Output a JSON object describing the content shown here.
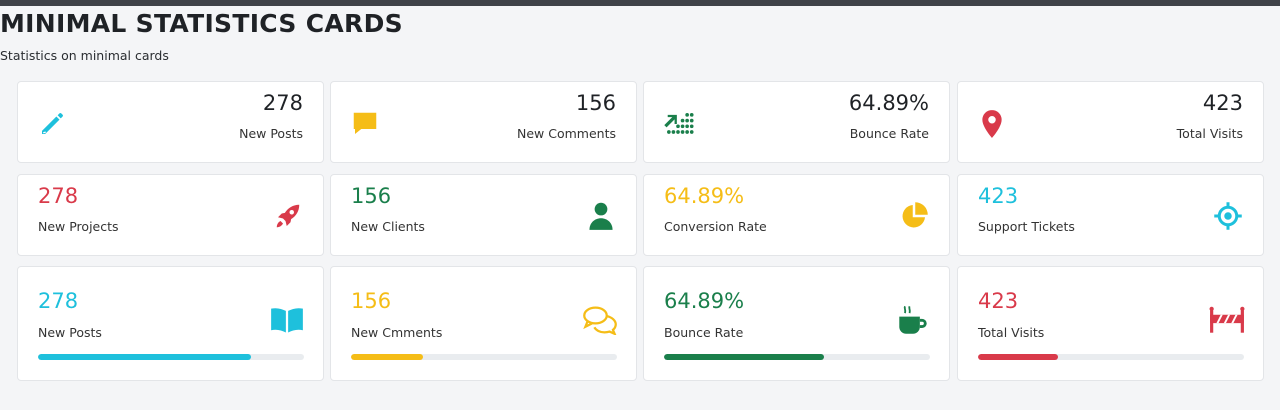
{
  "header": {
    "title": "MINIMAL STATISTICS CARDS",
    "subtitle": "Statistics on minimal cards"
  },
  "colors": {
    "cyan": "#1ec0dc",
    "yellow": "#f5bd17",
    "green": "#1a7f4b",
    "red": "#d93a4a"
  },
  "row1": [
    {
      "value": "278",
      "label": "New Posts",
      "icon": "pencil-icon"
    },
    {
      "value": "156",
      "label": "New Comments",
      "icon": "comment-icon"
    },
    {
      "value": "64.89%",
      "label": "Bounce Rate",
      "icon": "trend-up-dots-icon"
    },
    {
      "value": "423",
      "label": "Total Visits",
      "icon": "map-pin-icon"
    }
  ],
  "row2": [
    {
      "value": "278",
      "label": "New Projects",
      "icon": "rocket-icon"
    },
    {
      "value": "156",
      "label": "New Clients",
      "icon": "user-icon"
    },
    {
      "value": "64.89%",
      "label": "Conversion Rate",
      "icon": "pie-chart-icon"
    },
    {
      "value": "423",
      "label": "Support Tickets",
      "icon": "target-icon"
    }
  ],
  "row3": [
    {
      "value": "278",
      "label": "New Posts",
      "icon": "book-open-icon",
      "progress": 0.8
    },
    {
      "value": "156",
      "label": "New Cmments",
      "icon": "chat-bubbles-icon",
      "progress": 0.27
    },
    {
      "value": "64.89%",
      "label": "Bounce Rate",
      "icon": "coffee-cup-icon",
      "progress": 0.6
    },
    {
      "value": "423",
      "label": "Total Visits",
      "icon": "road-barrier-icon",
      "progress": 0.3
    }
  ]
}
